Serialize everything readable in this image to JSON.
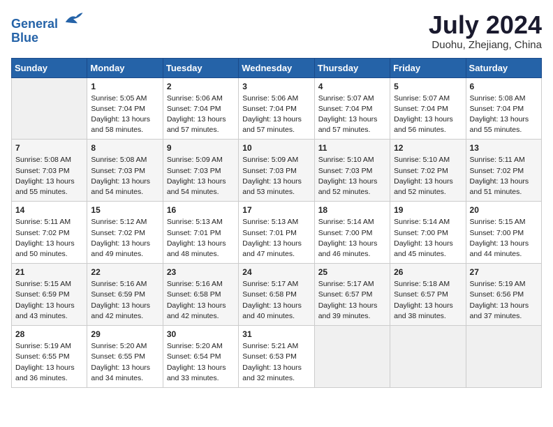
{
  "header": {
    "logo_line1": "General",
    "logo_line2": "Blue",
    "month_title": "July 2024",
    "location": "Duohu, Zhejiang, China"
  },
  "columns": [
    "Sunday",
    "Monday",
    "Tuesday",
    "Wednesday",
    "Thursday",
    "Friday",
    "Saturday"
  ],
  "weeks": [
    [
      {
        "day": "",
        "info": ""
      },
      {
        "day": "1",
        "info": "Sunrise: 5:05 AM\nSunset: 7:04 PM\nDaylight: 13 hours\nand 58 minutes."
      },
      {
        "day": "2",
        "info": "Sunrise: 5:06 AM\nSunset: 7:04 PM\nDaylight: 13 hours\nand 57 minutes."
      },
      {
        "day": "3",
        "info": "Sunrise: 5:06 AM\nSunset: 7:04 PM\nDaylight: 13 hours\nand 57 minutes."
      },
      {
        "day": "4",
        "info": "Sunrise: 5:07 AM\nSunset: 7:04 PM\nDaylight: 13 hours\nand 57 minutes."
      },
      {
        "day": "5",
        "info": "Sunrise: 5:07 AM\nSunset: 7:04 PM\nDaylight: 13 hours\nand 56 minutes."
      },
      {
        "day": "6",
        "info": "Sunrise: 5:08 AM\nSunset: 7:04 PM\nDaylight: 13 hours\nand 55 minutes."
      }
    ],
    [
      {
        "day": "7",
        "info": "Sunrise: 5:08 AM\nSunset: 7:03 PM\nDaylight: 13 hours\nand 55 minutes."
      },
      {
        "day": "8",
        "info": "Sunrise: 5:08 AM\nSunset: 7:03 PM\nDaylight: 13 hours\nand 54 minutes."
      },
      {
        "day": "9",
        "info": "Sunrise: 5:09 AM\nSunset: 7:03 PM\nDaylight: 13 hours\nand 54 minutes."
      },
      {
        "day": "10",
        "info": "Sunrise: 5:09 AM\nSunset: 7:03 PM\nDaylight: 13 hours\nand 53 minutes."
      },
      {
        "day": "11",
        "info": "Sunrise: 5:10 AM\nSunset: 7:03 PM\nDaylight: 13 hours\nand 52 minutes."
      },
      {
        "day": "12",
        "info": "Sunrise: 5:10 AM\nSunset: 7:02 PM\nDaylight: 13 hours\nand 52 minutes."
      },
      {
        "day": "13",
        "info": "Sunrise: 5:11 AM\nSunset: 7:02 PM\nDaylight: 13 hours\nand 51 minutes."
      }
    ],
    [
      {
        "day": "14",
        "info": "Sunrise: 5:11 AM\nSunset: 7:02 PM\nDaylight: 13 hours\nand 50 minutes."
      },
      {
        "day": "15",
        "info": "Sunrise: 5:12 AM\nSunset: 7:02 PM\nDaylight: 13 hours\nand 49 minutes."
      },
      {
        "day": "16",
        "info": "Sunrise: 5:13 AM\nSunset: 7:01 PM\nDaylight: 13 hours\nand 48 minutes."
      },
      {
        "day": "17",
        "info": "Sunrise: 5:13 AM\nSunset: 7:01 PM\nDaylight: 13 hours\nand 47 minutes."
      },
      {
        "day": "18",
        "info": "Sunrise: 5:14 AM\nSunset: 7:00 PM\nDaylight: 13 hours\nand 46 minutes."
      },
      {
        "day": "19",
        "info": "Sunrise: 5:14 AM\nSunset: 7:00 PM\nDaylight: 13 hours\nand 45 minutes."
      },
      {
        "day": "20",
        "info": "Sunrise: 5:15 AM\nSunset: 7:00 PM\nDaylight: 13 hours\nand 44 minutes."
      }
    ],
    [
      {
        "day": "21",
        "info": "Sunrise: 5:15 AM\nSunset: 6:59 PM\nDaylight: 13 hours\nand 43 minutes."
      },
      {
        "day": "22",
        "info": "Sunrise: 5:16 AM\nSunset: 6:59 PM\nDaylight: 13 hours\nand 42 minutes."
      },
      {
        "day": "23",
        "info": "Sunrise: 5:16 AM\nSunset: 6:58 PM\nDaylight: 13 hours\nand 42 minutes."
      },
      {
        "day": "24",
        "info": "Sunrise: 5:17 AM\nSunset: 6:58 PM\nDaylight: 13 hours\nand 40 minutes."
      },
      {
        "day": "25",
        "info": "Sunrise: 5:17 AM\nSunset: 6:57 PM\nDaylight: 13 hours\nand 39 minutes."
      },
      {
        "day": "26",
        "info": "Sunrise: 5:18 AM\nSunset: 6:57 PM\nDaylight: 13 hours\nand 38 minutes."
      },
      {
        "day": "27",
        "info": "Sunrise: 5:19 AM\nSunset: 6:56 PM\nDaylight: 13 hours\nand 37 minutes."
      }
    ],
    [
      {
        "day": "28",
        "info": "Sunrise: 5:19 AM\nSunset: 6:55 PM\nDaylight: 13 hours\nand 36 minutes."
      },
      {
        "day": "29",
        "info": "Sunrise: 5:20 AM\nSunset: 6:55 PM\nDaylight: 13 hours\nand 34 minutes."
      },
      {
        "day": "30",
        "info": "Sunrise: 5:20 AM\nSunset: 6:54 PM\nDaylight: 13 hours\nand 33 minutes."
      },
      {
        "day": "31",
        "info": "Sunrise: 5:21 AM\nSunset: 6:53 PM\nDaylight: 13 hours\nand 32 minutes."
      },
      {
        "day": "",
        "info": ""
      },
      {
        "day": "",
        "info": ""
      },
      {
        "day": "",
        "info": ""
      }
    ]
  ]
}
